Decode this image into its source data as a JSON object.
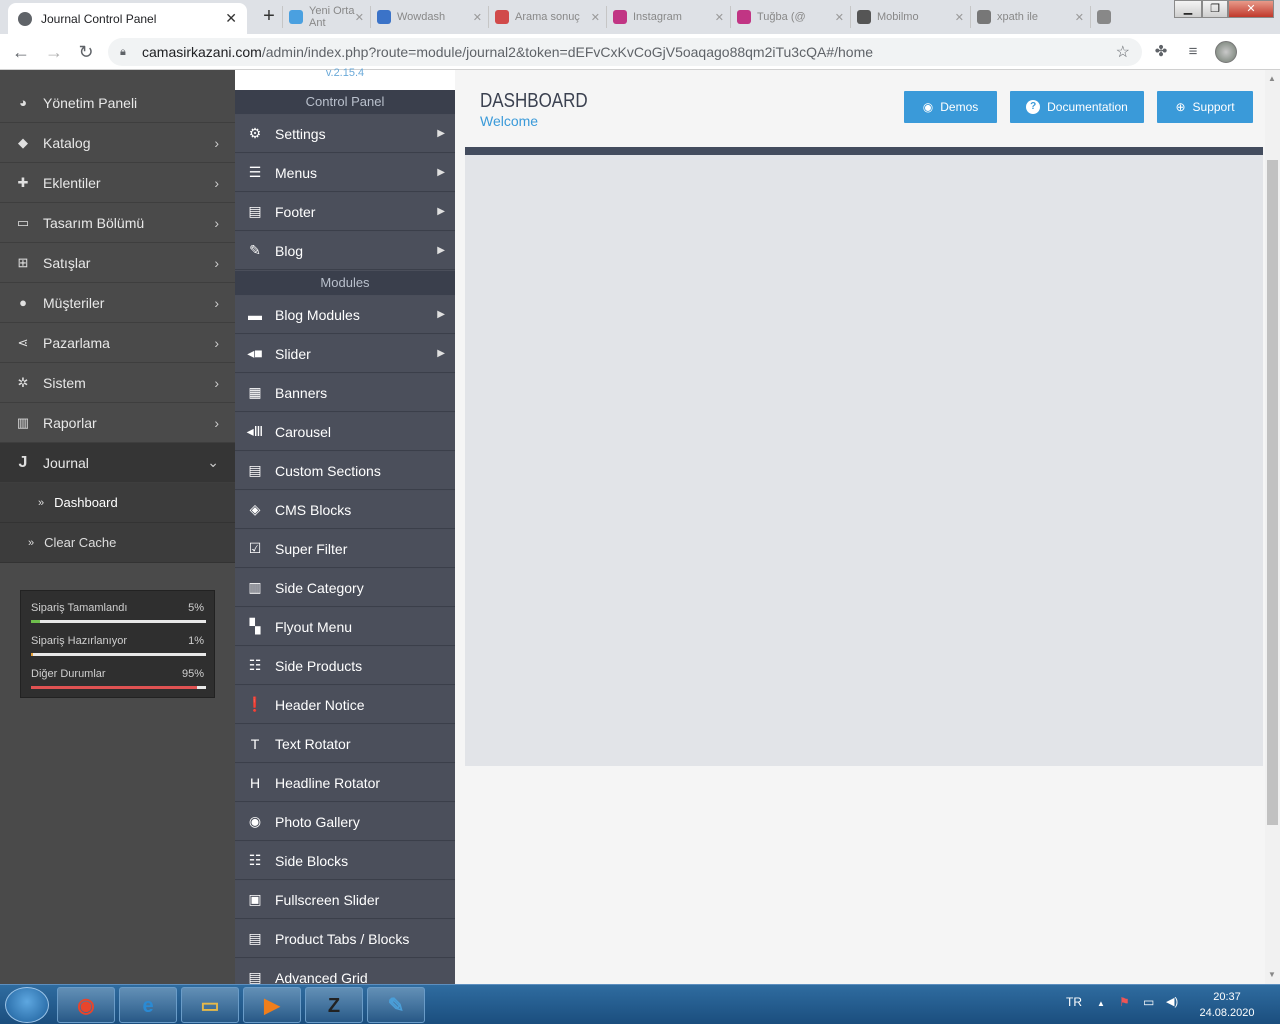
{
  "browser": {
    "active_tab": {
      "title": "Journal Control Panel",
      "close": "✕"
    },
    "new_tab": "+",
    "bg_tabs": [
      {
        "title": "Yeni Orta Ant",
        "color": "#4aa0e0"
      },
      {
        "title": "Wowdash",
        "color": "#3b73c8"
      },
      {
        "title": "Arama sonuç",
        "color": "#d14a4a"
      },
      {
        "title": "Instagram",
        "color": "#c13584"
      },
      {
        "title": "Tuğba (@",
        "color": "#c13584"
      },
      {
        "title": "Mobilmo",
        "color": "#555555"
      },
      {
        "title": "xpath ile",
        "color": "#777777"
      },
      {
        "title": "",
        "color": "#888888"
      }
    ],
    "window": {
      "minimize": "▁",
      "restore": "❐",
      "close": "✕"
    },
    "url_host": "camasirkazani.com",
    "url_path": "/admin/index.php?route=module/journal2&token=dEFvCxKvCoGjV5oaqago88qm2iTu3cQA#/home",
    "icons": {
      "back": "arrow-left",
      "forward": "arrow-right",
      "reload": "reload",
      "star": "star",
      "extensions": "puzzle",
      "media": "media-list"
    }
  },
  "sidebar": {
    "items": [
      {
        "label": "Yönetim Paneli",
        "icon": "◕",
        "chevron": ""
      },
      {
        "label": "Katalog",
        "icon": "◆",
        "chevron": "›"
      },
      {
        "label": "Eklentiler",
        "icon": "✚",
        "chevron": "›"
      },
      {
        "label": "Tasarım Bölümü",
        "icon": "▭",
        "chevron": "›"
      },
      {
        "label": "Satışlar",
        "icon": "⊞",
        "chevron": "›"
      },
      {
        "label": "Müşteriler",
        "icon": "●",
        "chevron": "›"
      },
      {
        "label": "Pazarlama",
        "icon": "⋖",
        "chevron": "›"
      },
      {
        "label": "Sistem",
        "icon": "✲",
        "chevron": "›"
      },
      {
        "label": "Raporlar",
        "icon": "▥",
        "chevron": "›"
      },
      {
        "label": "Journal",
        "icon": "J",
        "chevron": "⌄"
      }
    ],
    "subitems": [
      {
        "label": "Dashboard",
        "icon": "»"
      },
      {
        "label": "Clear Cache",
        "icon": "»"
      }
    ],
    "stats": [
      {
        "label": "Sipariş Tamamlandı",
        "percent_text": "5%",
        "value": 5,
        "color": "#6fbf4d"
      },
      {
        "label": "Sipariş Hazırlanıyor",
        "percent_text": "1%",
        "value": 1,
        "color": "#e5a23a"
      },
      {
        "label": "Diğer Durumlar",
        "percent_text": "95%",
        "value": 95,
        "color": "#e05252"
      }
    ]
  },
  "panel": {
    "version": "v.2.15.4",
    "header_control": "Control Panel",
    "control_items": [
      {
        "label": "Settings",
        "icon": "⚙",
        "arrow": "▶"
      },
      {
        "label": "Menus",
        "icon": "☰",
        "arrow": "▶"
      },
      {
        "label": "Footer",
        "icon": "▤",
        "arrow": "▶"
      },
      {
        "label": "Blog",
        "icon": "✎",
        "arrow": "▶"
      }
    ],
    "header_modules": "Modules",
    "module_items": [
      {
        "label": "Blog Modules",
        "icon": "▬",
        "arrow": "▶"
      },
      {
        "label": "Slider",
        "icon": "◂■",
        "arrow": "▶"
      },
      {
        "label": "Banners",
        "icon": "▦",
        "arrow": ""
      },
      {
        "label": "Carousel",
        "icon": "◂Ⅲ",
        "arrow": ""
      },
      {
        "label": "Custom Sections",
        "icon": "▤",
        "arrow": ""
      },
      {
        "label": "CMS Blocks",
        "icon": "◈",
        "arrow": ""
      },
      {
        "label": "Super Filter",
        "icon": "☑",
        "arrow": ""
      },
      {
        "label": "Side Category",
        "icon": "▥",
        "arrow": ""
      },
      {
        "label": "Flyout Menu",
        "icon": "▚",
        "arrow": ""
      },
      {
        "label": "Side Products",
        "icon": "☷",
        "arrow": ""
      },
      {
        "label": "Header Notice",
        "icon": "❗",
        "arrow": ""
      },
      {
        "label": "Text Rotator",
        "icon": "T",
        "arrow": ""
      },
      {
        "label": "Headline Rotator",
        "icon": "H",
        "arrow": ""
      },
      {
        "label": "Photo Gallery",
        "icon": "◉",
        "arrow": ""
      },
      {
        "label": "Side Blocks",
        "icon": "☷",
        "arrow": ""
      },
      {
        "label": "Fullscreen Slider",
        "icon": "▣",
        "arrow": ""
      },
      {
        "label": "Product Tabs / Blocks",
        "icon": "▤",
        "arrow": ""
      },
      {
        "label": "Advanced Grid",
        "icon": "▤",
        "arrow": ""
      }
    ]
  },
  "main": {
    "title": "DASHBOARD",
    "subtitle": "Welcome",
    "buttons": [
      {
        "label": "Demos",
        "icon": "◉"
      },
      {
        "label": "Documentation",
        "icon": "?"
      },
      {
        "label": "Support",
        "icon": "⊕"
      }
    ]
  },
  "taskbar": {
    "lang": "TR",
    "time": "20:37",
    "date": "24.08.2020",
    "apps": [
      {
        "glyph": "◉",
        "color": "#e8452c"
      },
      {
        "glyph": "e",
        "color": "#2a8ad4"
      },
      {
        "glyph": "▭",
        "color": "#e6b84a"
      },
      {
        "glyph": "▶",
        "color": "#f07e1b"
      },
      {
        "glyph": "Z",
        "color": "#222222"
      },
      {
        "glyph": "✎",
        "color": "#4a9ed8"
      }
    ],
    "tray_icons": {
      "up": "▲",
      "flag": "⚑",
      "network": "▭",
      "volume": "◀)"
    }
  }
}
